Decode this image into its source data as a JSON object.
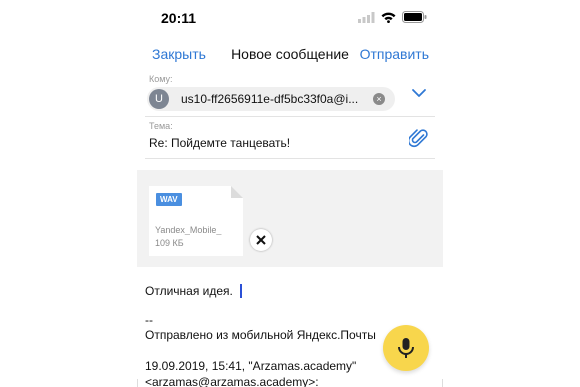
{
  "status_bar": {
    "time": "20:11",
    "icons": [
      "signal-icon",
      "wifi-icon",
      "battery-icon"
    ]
  },
  "navbar": {
    "close_label": "Закрыть",
    "title": "Новое сообщение",
    "send_label": "Отправить"
  },
  "to_field": {
    "label": "Кому:",
    "recipient_initial": "U",
    "recipient": "us10-ff2656911e-df5bc33f0a@i...",
    "remove_icon": "×"
  },
  "subject_field": {
    "label": "Тема:",
    "value": "Re: Пойдемте танцевать!"
  },
  "attachment": {
    "type": "WAV",
    "name": "Yandex_Mobile_",
    "size": "109 КБ"
  },
  "body": {
    "line1": "Отличная идея.",
    "line2": "--",
    "line3": "Отправлено из мобильной Яндекс.Почты",
    "line4": "19.09.2019, 15:41, \"Arzamas.academy\"",
    "line5": "<arzamas@arzamas.academy>:"
  },
  "colors": {
    "accent": "#2f78d4",
    "fab": "#f8d64c",
    "attachment_bg": "#f2f2f2",
    "file_badge": "#4a8fe0"
  }
}
